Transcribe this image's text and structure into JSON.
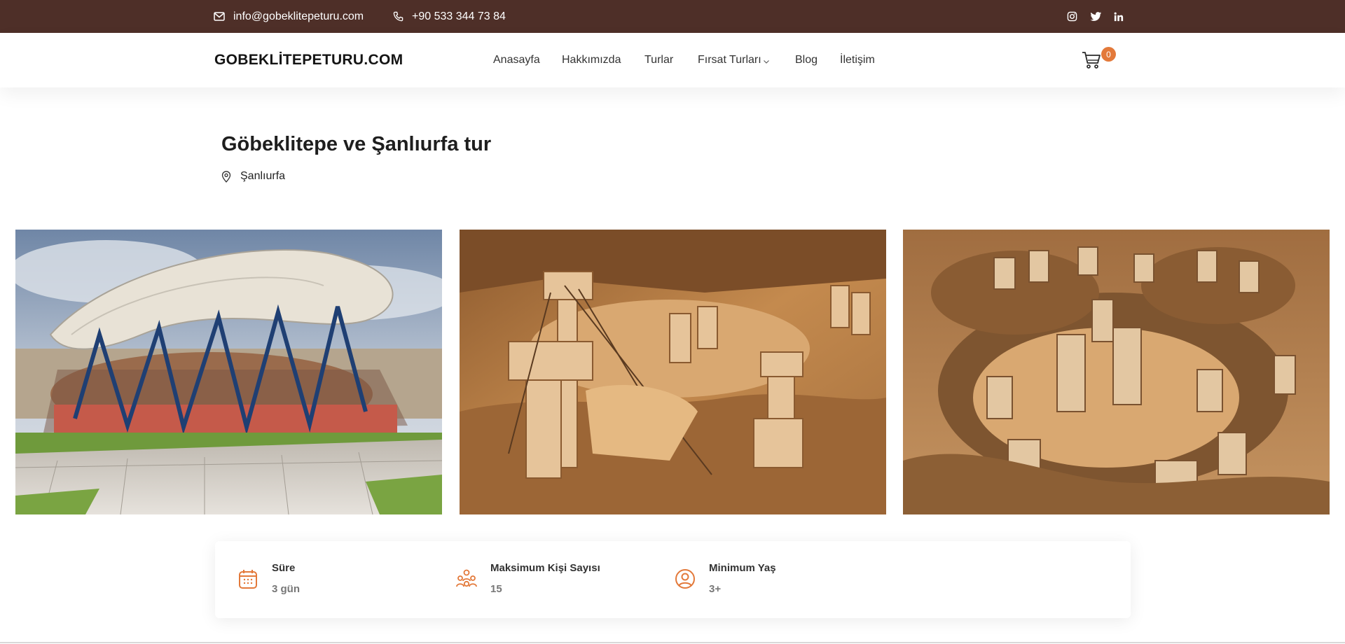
{
  "topbar": {
    "email": "info@gobeklitepeturu.com",
    "phone": "+90 533 344 73 84",
    "icons": {
      "email": "envelope-icon",
      "phone": "phone-icon",
      "social": [
        "instagram-icon",
        "twitter-icon",
        "linkedin-icon"
      ]
    }
  },
  "header": {
    "logo": "GOBEKLİTEPETURU.COM",
    "nav": [
      "Anasayfa",
      "Hakkımızda",
      "Turlar",
      "Fırsat Turları",
      "Blog",
      "İletişim"
    ],
    "cart_count": "0",
    "cart_icon": "cart-icon"
  },
  "tour": {
    "title": "Göbeklitepe ve Şanlıurfa tur",
    "location": "Şanlıurfa",
    "location_icon": "map-pin-icon"
  },
  "gallery": [
    "canopy-structure-photo",
    "excavation-pillars-photo",
    "stone-circle-photo"
  ],
  "details": [
    {
      "label": "Süre",
      "value": "3 gün",
      "icon": "calendar-icon"
    },
    {
      "label": "Maksimum Kişi Sayısı",
      "value": "15",
      "icon": "group-icon"
    },
    {
      "label": "Minimum Yaş",
      "value": "3+",
      "icon": "user-circle-icon"
    }
  ],
  "colors": {
    "topbar": "#4e2f28",
    "accent": "#e3793a"
  }
}
